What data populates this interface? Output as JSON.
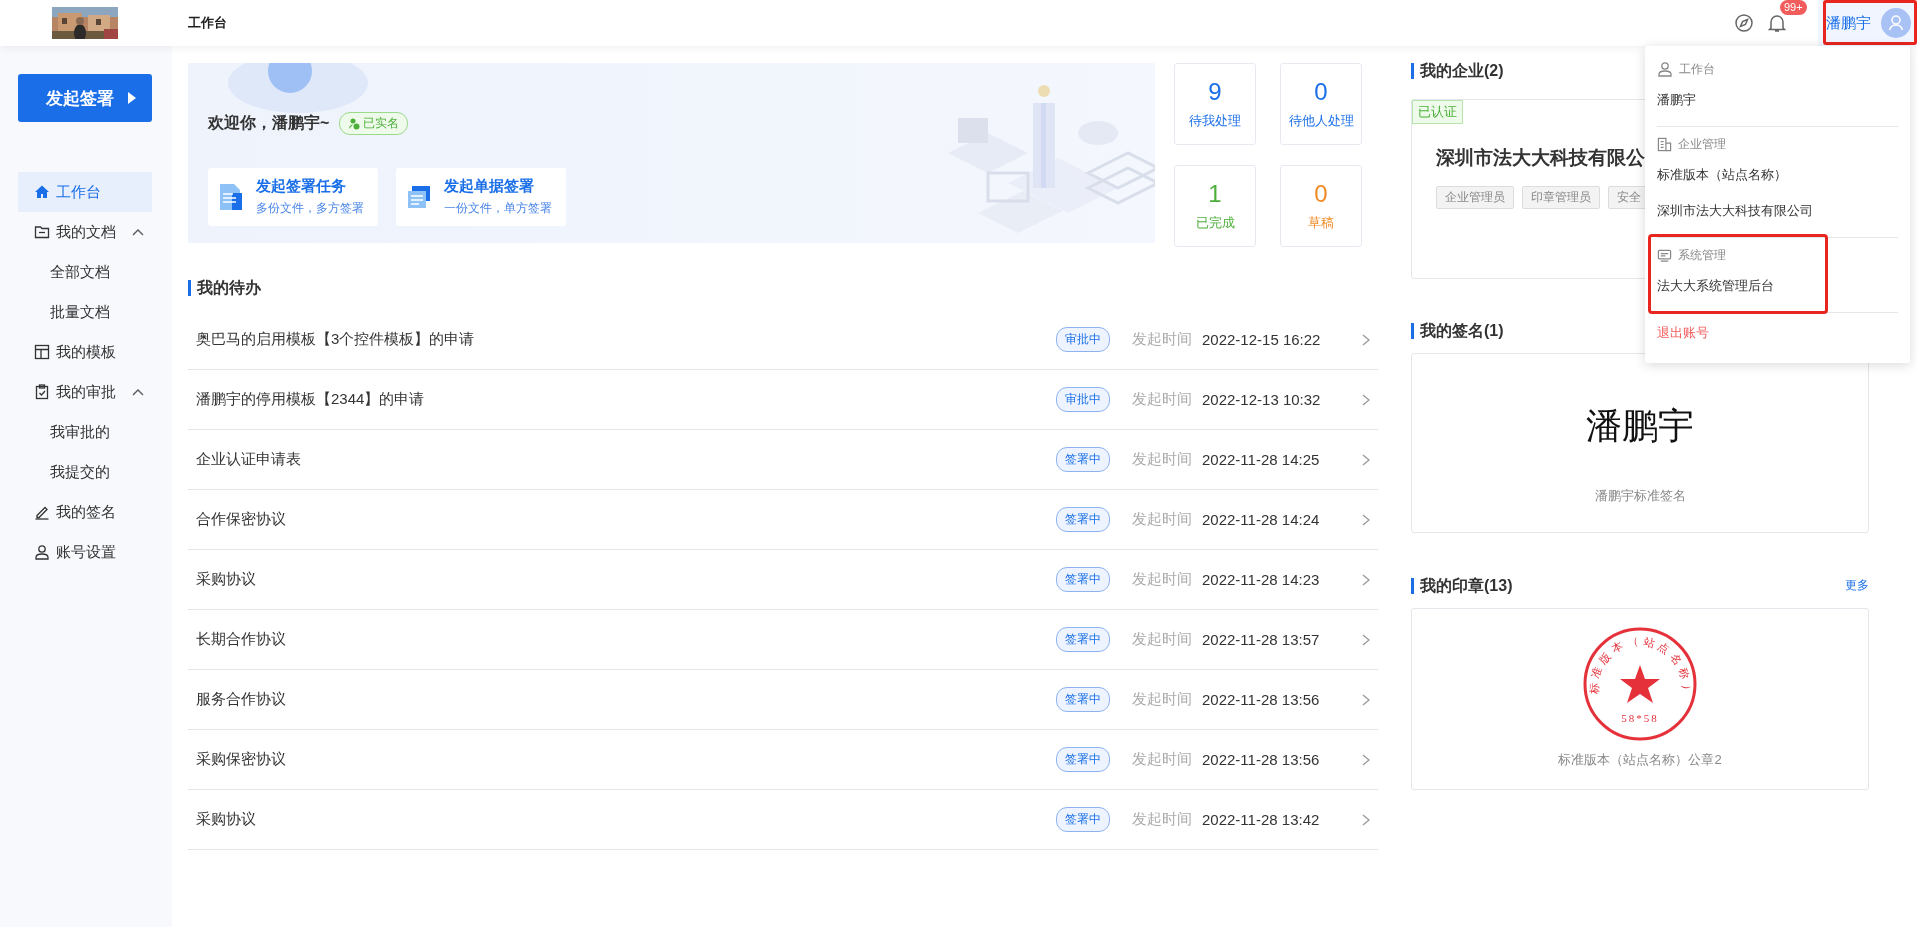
{
  "header": {
    "title": "工作台",
    "notifications_badge": "99+",
    "user_name": "潘鹏宇",
    "highlighted": true
  },
  "sidebar": {
    "primary_button": "发起签署",
    "items": [
      {
        "label": "工作台",
        "selected": true
      },
      {
        "label": "我的文档",
        "selected": false,
        "expanded": true,
        "children": [
          {
            "label": "全部文档",
            "selected": false
          },
          {
            "label": "批量文档",
            "selected": false
          }
        ]
      },
      {
        "label": "我的模板",
        "selected": false
      },
      {
        "label": "我的审批",
        "selected": false,
        "expanded": true,
        "children": [
          {
            "label": "我审批的",
            "selected": false
          },
          {
            "label": "我提交的",
            "selected": false
          }
        ]
      },
      {
        "label": "我的签名",
        "selected": false
      },
      {
        "label": "账号设置",
        "selected": false
      }
    ]
  },
  "banner": {
    "greeting": "欢迎你，潘鹏宇~",
    "verified_badge": "已实名",
    "actions": [
      {
        "title": "发起签署任务",
        "subtitle": "多份文件，多方签署"
      },
      {
        "title": "发起单据签署",
        "subtitle": "一份文件，单方签署"
      }
    ]
  },
  "stats": [
    {
      "value": "9",
      "label": "待我处理",
      "color": "#1a6fe8"
    },
    {
      "value": "0",
      "label": "待他人处理",
      "color": "#1a6fe8"
    },
    {
      "value": "1",
      "label": "已完成",
      "color": "#4caf3a"
    },
    {
      "value": "0",
      "label": "草稿",
      "color": "#f08a24"
    }
  ],
  "todo": {
    "title": "我的待办",
    "rows": [
      {
        "name": "奥巴马的启用模板【3个控件模板】的申请",
        "status": "审批中",
        "time_label": "发起时间",
        "time": "2022-12-15 16:22"
      },
      {
        "name": "潘鹏宇的停用模板【2344】的申请",
        "status": "审批中",
        "time_label": "发起时间",
        "time": "2022-12-13 10:32"
      },
      {
        "name": "企业认证申请表",
        "status": "签署中",
        "time_label": "发起时间",
        "time": "2022-11-28 14:25"
      },
      {
        "name": "合作保密协议",
        "status": "签署中",
        "time_label": "发起时间",
        "time": "2022-11-28 14:24"
      },
      {
        "name": "采购协议",
        "status": "签署中",
        "time_label": "发起时间",
        "time": "2022-11-28 14:23"
      },
      {
        "name": "长期合作协议",
        "status": "签署中",
        "time_label": "发起时间",
        "time": "2022-11-28 13:57"
      },
      {
        "name": "服务合作协议",
        "status": "签署中",
        "time_label": "发起时间",
        "time": "2022-11-28 13:56"
      },
      {
        "name": "采购保密协议",
        "status": "签署中",
        "time_label": "发起时间",
        "time": "2022-11-28 13:56"
      },
      {
        "name": "采购协议",
        "status": "签署中",
        "time_label": "发起时间",
        "time": "2022-11-28 13:42"
      }
    ]
  },
  "companies": {
    "title": "我的企业(2)",
    "badge": "已认证",
    "name": "深圳市法大大科技有限公",
    "tags": [
      "企业管理员",
      "印章管理员",
      "安全"
    ]
  },
  "signature": {
    "title": "我的签名(1)",
    "signature": "潘鹏宇",
    "caption": "潘鹏宇标准签名"
  },
  "seals": {
    "title": "我的印章(13)",
    "more_link": "更多",
    "seal_text": "标准版本（站点名称）",
    "seal_size": "58*58",
    "caption": "标准版本（站点名称）公章2"
  },
  "user_menu": {
    "sections": [
      {
        "heading": "工作台",
        "items": [
          "潘鹏宇"
        ],
        "highlighted": false
      },
      {
        "heading": "企业管理",
        "items": [
          "标准版本（站点名称）",
          "深圳市法大大科技有限公司"
        ],
        "highlighted": false
      },
      {
        "heading": "系统管理",
        "items": [
          "法大大系统管理后台"
        ],
        "highlighted": true
      }
    ],
    "logout": "退出账号"
  }
}
